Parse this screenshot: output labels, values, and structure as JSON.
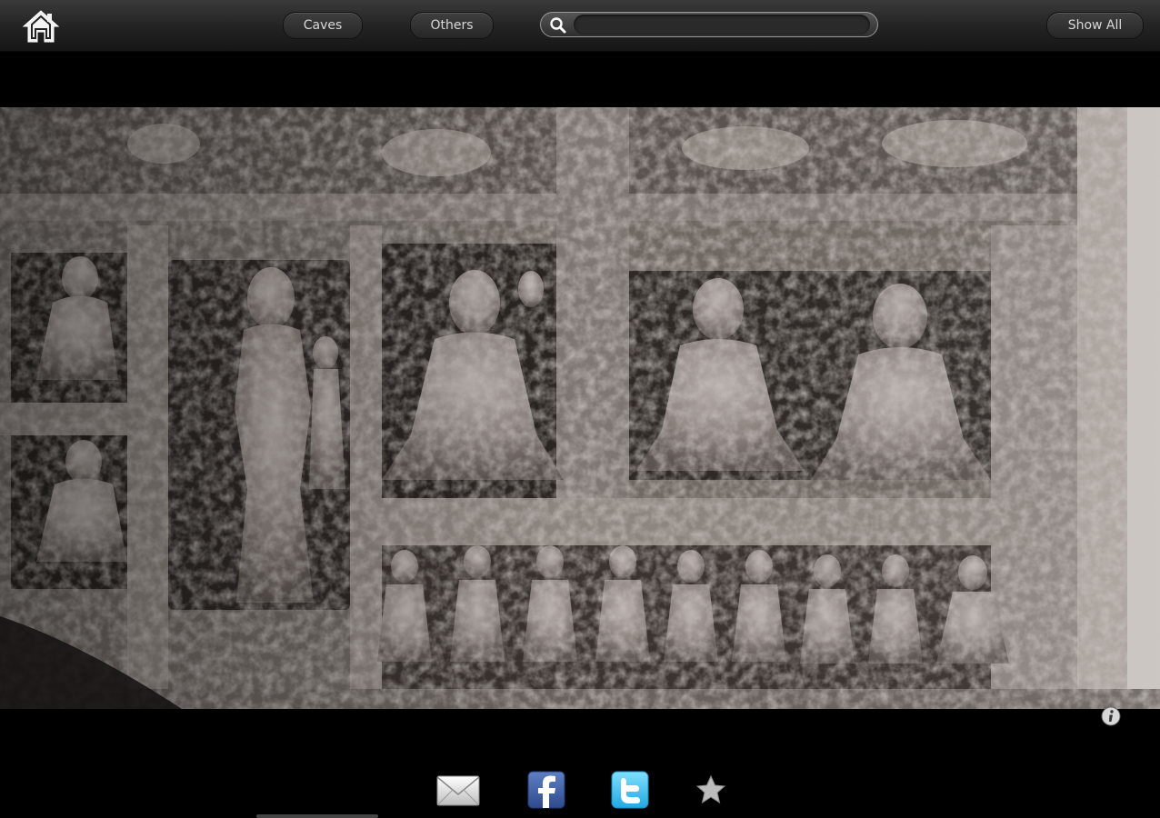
{
  "toolbar": {
    "caves_label": "Caves",
    "others_label": "Others",
    "show_all_label": "Show All"
  },
  "search": {
    "value": "",
    "placeholder": ""
  },
  "icons": {
    "home": "home-icon",
    "search": "search-icon",
    "info": "info-icon",
    "mail": "mail-icon",
    "facebook": "facebook-icon",
    "twitter": "twitter-icon",
    "favorite": "star-icon"
  },
  "colors": {
    "background": "#000000",
    "toolbar": "#262626",
    "facebook": "#3b5998",
    "twitter": "#33ccff"
  }
}
